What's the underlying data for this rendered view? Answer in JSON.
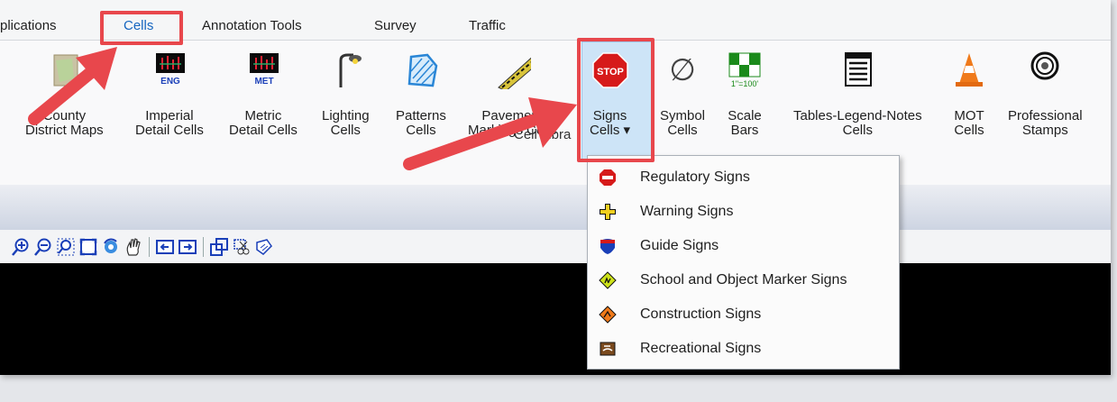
{
  "tabs": [
    {
      "label": "plications"
    },
    {
      "label": "Cells"
    },
    {
      "label": "Annotation Tools"
    },
    {
      "label": "Survey"
    },
    {
      "label": "Traffic"
    }
  ],
  "ribbon": {
    "group_label": "Cell Libra",
    "buttons": [
      {
        "label": "County\nDistrict Maps",
        "icon": "county-map-icon"
      },
      {
        "label": "Imperial\nDetail Cells",
        "icon": "imperial-eng-icon",
        "badge": "ENG"
      },
      {
        "label": "Metric\nDetail Cells",
        "icon": "metric-met-icon",
        "badge": "MET"
      },
      {
        "label": "Lighting\nCells",
        "icon": "street-light-icon"
      },
      {
        "label": "Patterns\nCells",
        "icon": "pattern-hatch-icon"
      },
      {
        "label": "Pavement\nMarkings Cells",
        "icon": "pavement-marking-icon"
      },
      {
        "label": "Signs\nCells ▾",
        "icon": "stop-sign-icon",
        "badge": "STOP"
      },
      {
        "label": "Symbol\nCells",
        "icon": "empty-set-symbol-icon",
        "badge": "∅"
      },
      {
        "label": "Scale\nBars",
        "icon": "scale-bar-icon",
        "badge": "1\"=100'"
      },
      {
        "label": "Tables-Legend-Notes\nCells",
        "icon": "table-legend-icon"
      },
      {
        "label": "MOT\nCells",
        "icon": "traffic-cone-icon"
      },
      {
        "label": "Professional\nStamps",
        "icon": "professional-stamp-icon"
      }
    ]
  },
  "toolbar": {
    "tools": [
      "zoom-in-icon",
      "zoom-out-icon",
      "zoom-window-icon",
      "fit-view-icon",
      "rotate-view-icon",
      "pan-view-icon",
      "previous-view-icon",
      "next-view-icon",
      "copy-view-icon",
      "clip-volume-icon",
      "view-attributes-icon"
    ]
  },
  "menu": {
    "items": [
      {
        "label": "Regulatory Signs",
        "icon": "regulatory-sign-icon"
      },
      {
        "label": "Warning Signs",
        "icon": "warning-sign-icon"
      },
      {
        "label": "Guide Signs",
        "icon": "guide-sign-icon"
      },
      {
        "label": "School and Object Marker Signs",
        "icon": "school-sign-icon"
      },
      {
        "label": "Construction Signs",
        "icon": "construction-sign-icon"
      },
      {
        "label": "Recreational Signs",
        "icon": "recreational-sign-icon"
      }
    ]
  },
  "colors": {
    "highlight_red": "#e8474c",
    "active_tab_blue": "#1565c0",
    "selected_button_bg": "#cde4f7"
  }
}
